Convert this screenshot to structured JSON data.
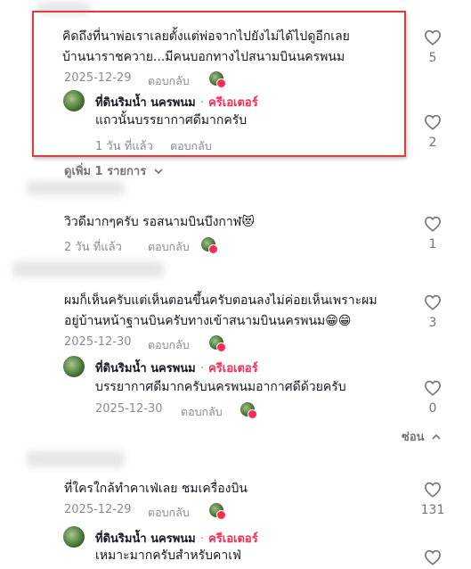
{
  "comments": [
    {
      "line1": "คิดถึงที่นาพ่อเราเลยตั้งแต่พ่อจากไปยังไม่ได้ไปดูอีกเลย",
      "line2": "บ้านนาราชควาย...มีคนบอกทางไปสนามบินนครพนม",
      "date": "2025-12-29",
      "reply": "ตอบกลับ",
      "likes": "5",
      "replies": [
        {
          "author": "ที่ดินริมน้ำ นครพนม",
          "sep": "·",
          "badge": "ครีเอเตอร์",
          "text": "แถวนั้นบรรยากาศดีมากครับ",
          "date": "1 วัน ที่แล้ว",
          "reply": "ตอบกลับ",
          "likes": "2"
        }
      ],
      "view_more": "ดูเพิ่ม 1 รายการ"
    },
    {
      "line1": "วิวดีมากๆครับ รอสนามบินบึงกาฬ😻",
      "date": "2 วัน ที่แล้ว",
      "reply": "ตอบกลับ",
      "likes": "1"
    },
    {
      "line1": "ผมก็เห็นครับแต่เห็นตอนขึ้นครับตอนลงไม่ค่อยเห็นเพราะผม",
      "line2": "อยู่บ้านหน้าฐานบินครับทางเข้าสนามบินนครพนม😁😁",
      "date": "2025-12-30",
      "reply": "ตอบกลับ",
      "likes": "3",
      "replies": [
        {
          "author": "ที่ดินริมน้ำ นครพนม",
          "sep": "·",
          "badge": "ครีเอเตอร์",
          "text": "บรรยากาศดีมากครับนครพนมอากาศดีด้วยครับ",
          "date": "2025-12-30",
          "reply": "ตอบกลับ",
          "likes": "0"
        }
      ],
      "hide": "ซ่อน"
    },
    {
      "line1": "ที่ใครใกล้ทำคาเฟ่เลย ชมเครื่องบิน",
      "date": "2025-12-29",
      "reply": "ตอบกลับ",
      "likes": "131",
      "replies": [
        {
          "author": "ที่ดินริมน้ำ นครพนม",
          "sep": "·",
          "badge": "ครีเอเตอร์",
          "text": "เหมาะมากครับสำหรับคาเฟ่"
        }
      ]
    }
  ],
  "colors": {
    "accent": "#fe2c55",
    "highlight_border": "#e23b3b",
    "muted": "#8a8b91"
  }
}
